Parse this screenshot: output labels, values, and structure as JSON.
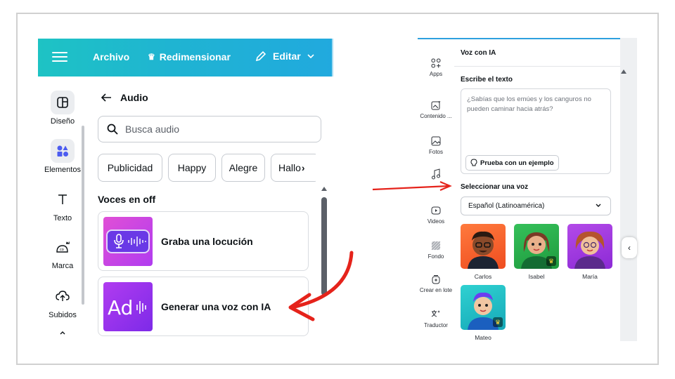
{
  "left_panel": {
    "topbar": {
      "file_label": "Archivo",
      "resize_label": "Redimensionar",
      "edit_label": "Editar"
    },
    "rail": [
      {
        "label": "Diseño",
        "icon": "layout-icon"
      },
      {
        "label": "Elementos",
        "icon": "shapes-icon"
      },
      {
        "label": "Texto",
        "icon": "text-icon"
      },
      {
        "label": "Marca",
        "icon": "brand-icon"
      },
      {
        "label": "Subidos",
        "icon": "cloud-upload-icon"
      }
    ],
    "audio": {
      "title": "Audio",
      "search_placeholder": "Busca audio",
      "chips": [
        "Publicidad",
        "Happy",
        "Alegre",
        "Hallo"
      ],
      "section_title": "Voces en off",
      "cards": [
        {
          "label": "Graba una locución"
        },
        {
          "label": "Generar una voz con IA"
        }
      ]
    }
  },
  "right_panel": {
    "rail": [
      {
        "label": "Apps"
      },
      {
        "label": "Contenido ..."
      },
      {
        "label": "Fotos"
      },
      {
        "label": "Audio"
      },
      {
        "label": "Videos"
      },
      {
        "label": "Fondo"
      },
      {
        "label": "Crear en lote"
      },
      {
        "label": "Traductor"
      }
    ],
    "title": "Voz con IA",
    "write_label": "Escribe el texto",
    "textbox_placeholder": "¿Sabías que los emúes y los canguros no pueden caminar hacia atrás?",
    "try_example_label": "Prueba con un ejemplo",
    "select_voice_label": "Seleccionar una voz",
    "language_value": "Español (Latinoamérica)",
    "voices": [
      "Carlos",
      "Isabel",
      "María",
      "Mateo"
    ]
  },
  "colors": {
    "topbar_start": "#1ec3c4",
    "topbar_end": "#21a9de",
    "annotation_red": "#e5231b",
    "accent_purple": "#7d2ae8"
  }
}
